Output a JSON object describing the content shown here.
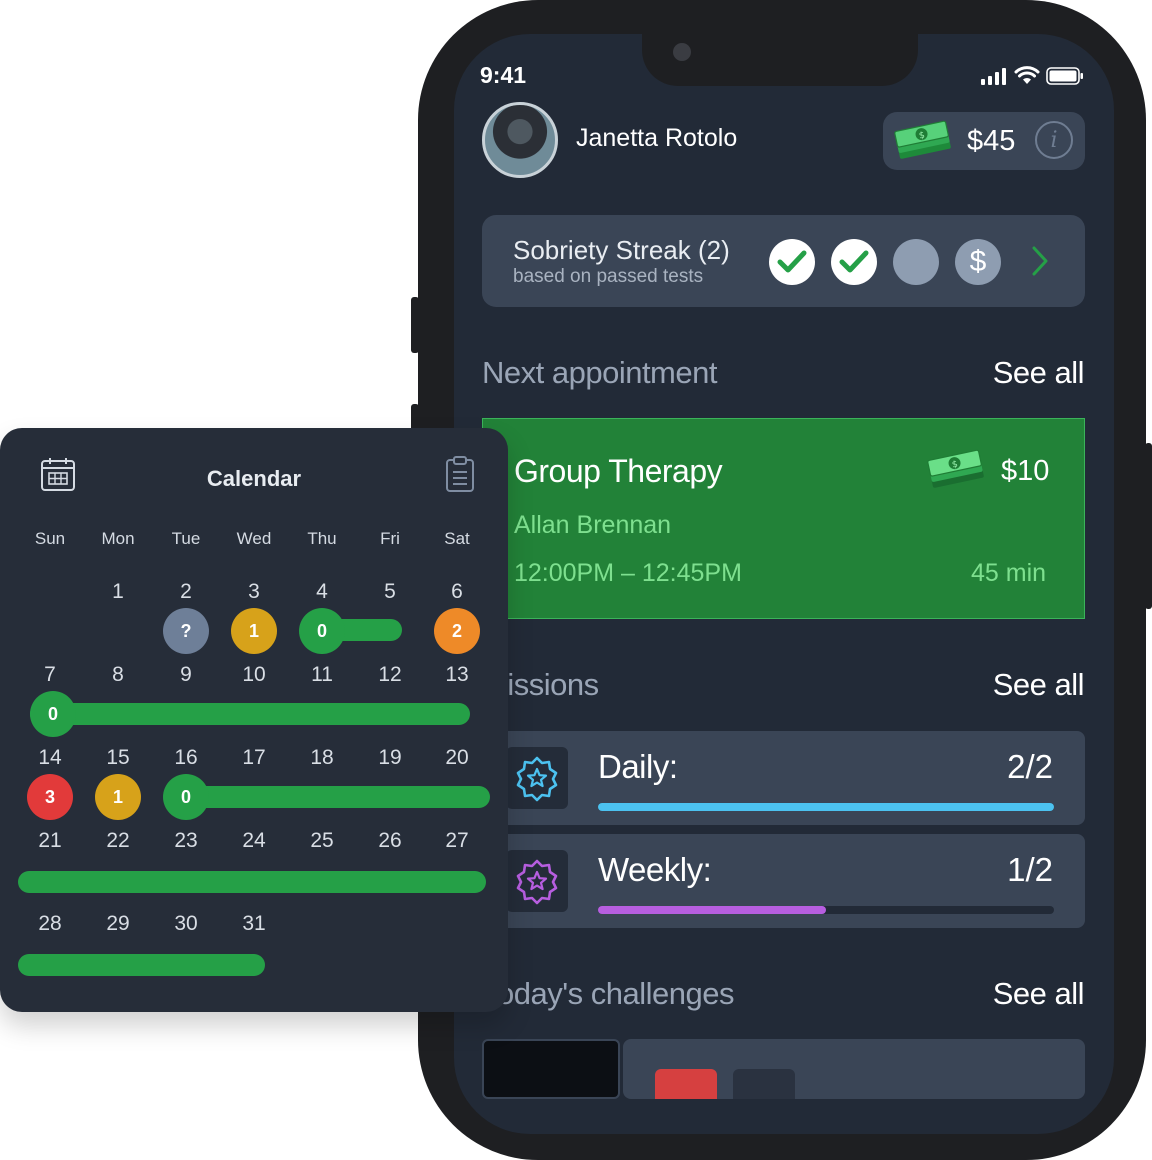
{
  "status_bar": {
    "time": "9:41"
  },
  "profile": {
    "name": "Janetta Rotolo",
    "balance": "$45"
  },
  "streak": {
    "title": "Sobriety Streak (2)",
    "subtitle": "based on passed tests",
    "states": [
      "passed",
      "passed",
      "pending",
      "reward"
    ]
  },
  "next_appointment": {
    "section_title": "Next appointment",
    "see_all": "See all",
    "title": "Group Therapy",
    "price": "$10",
    "person": "Allan Brennan",
    "time": "12:00PM – 12:45PM",
    "duration": "45 min"
  },
  "missions": {
    "section_title": "Missions",
    "see_all": "See all",
    "items": [
      {
        "label": "Daily:",
        "count": "2/2",
        "progress": 1.0,
        "color": "#4cc2f0"
      },
      {
        "label": "Weekly:",
        "count": "1/2",
        "progress": 0.5,
        "color": "#b75ee0"
      }
    ]
  },
  "challenges": {
    "section_title": "Today's challenges",
    "see_all": "See all"
  },
  "calendar": {
    "title": "Calendar",
    "weekdays": [
      "Sun",
      "Mon",
      "Tue",
      "Wed",
      "Thu",
      "Fri",
      "Sat"
    ],
    "weeks": [
      [
        "",
        "1",
        "2",
        "3",
        "4",
        "5",
        "6"
      ],
      [
        "7",
        "8",
        "9",
        "10",
        "11",
        "12",
        "13"
      ],
      [
        "14",
        "15",
        "16",
        "17",
        "18",
        "19",
        "20"
      ],
      [
        "21",
        "22",
        "23",
        "24",
        "25",
        "26",
        "27"
      ],
      [
        "28",
        "29",
        "30",
        "31",
        "",
        "",
        ""
      ]
    ],
    "badges": [
      {
        "day": "2",
        "text": "?",
        "color": "#6e7f98"
      },
      {
        "day": "3",
        "text": "1",
        "color": "#d7a21a"
      },
      {
        "day": "4",
        "text": "0",
        "color": "#25a047"
      },
      {
        "day": "6",
        "text": "2",
        "color": "#ee8a28"
      },
      {
        "day": "7",
        "text": "0",
        "color": "#25a047"
      },
      {
        "day": "14",
        "text": "3",
        "color": "#e23a3a"
      },
      {
        "day": "15",
        "text": "1",
        "color": "#d7a21a"
      },
      {
        "day": "16",
        "text": "0",
        "color": "#25a047"
      }
    ]
  },
  "colors": {
    "green": "#25a047",
    "card": "#3a4556",
    "screen": "#222a37"
  }
}
